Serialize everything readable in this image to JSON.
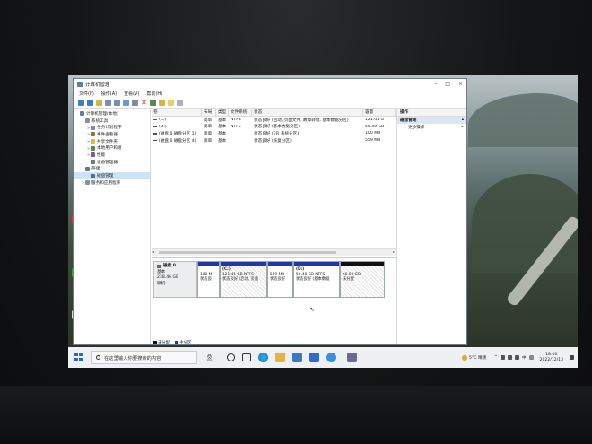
{
  "window": {
    "title": "计算机管理",
    "menu": [
      "文件(F)",
      "操作(A)",
      "查看(V)",
      "帮助(H)"
    ]
  },
  "tree": [
    {
      "label": "计算机管理(本地)",
      "icon": "computer-icon",
      "color": "#5a7ea6",
      "exp": "",
      "indent": 0
    },
    {
      "label": "系统工具",
      "icon": "tools-icon",
      "color": "#8a8f99",
      "exp": "⌄",
      "indent": 1
    },
    {
      "label": "任务计划程序",
      "icon": "clock-icon",
      "color": "#6c8fb8",
      "exp": ">",
      "indent": 2
    },
    {
      "label": "事件查看器",
      "icon": "event-icon",
      "color": "#9b6b3a",
      "exp": ">",
      "indent": 2
    },
    {
      "label": "共享文件夹",
      "icon": "folder-icon",
      "color": "#e2b53c",
      "exp": ">",
      "indent": 2
    },
    {
      "label": "本地用户和组",
      "icon": "users-icon",
      "color": "#5d8a4a",
      "exp": ">",
      "indent": 2
    },
    {
      "label": "性能",
      "icon": "performance-icon",
      "color": "#7a5aa6",
      "exp": ">",
      "indent": 2
    },
    {
      "label": "设备管理器",
      "icon": "device-icon",
      "color": "#6e7680",
      "exp": "",
      "indent": 2
    },
    {
      "label": "存储",
      "icon": "storage-icon",
      "color": "#6e7680",
      "exp": "⌄",
      "indent": 1
    },
    {
      "label": "磁盘管理",
      "icon": "disk-icon",
      "color": "#4f6f99",
      "exp": "",
      "indent": 2,
      "selected": true
    },
    {
      "label": "服务和应用程序",
      "icon": "services-icon",
      "color": "#8a8f99",
      "exp": ">",
      "indent": 1
    }
  ],
  "volume_table": {
    "headers": [
      "卷",
      "布局",
      "类型",
      "文件系统",
      "状态",
      "容量"
    ],
    "rows": [
      [
        "(C:)",
        "简单",
        "基本",
        "NTFS",
        "状态良好 (启动, 页面文件, 故障转储, 基本数据分区)",
        "121.41 G"
      ],
      [
        "(D:)",
        "简单",
        "基本",
        "NTFS",
        "状态良好 (基本数据分区)",
        "56.40 GB"
      ],
      [
        "(磁盘 0 磁盘分区 1)",
        "简单",
        "基本",
        "",
        "状态良好 (EFI 系统分区)",
        "100 MB"
      ],
      [
        "(磁盘 0 磁盘分区 4)",
        "简单",
        "基本",
        "",
        "状态良好 (恢复分区)",
        "559 MB"
      ]
    ]
  },
  "disk": {
    "name": "磁盘 0",
    "type": "基本",
    "size": "238.46 GB",
    "status": "联机",
    "partitions": [
      {
        "name": "",
        "size": "100 M",
        "status": "状态良",
        "kind": "primary",
        "width": 7
      },
      {
        "name": "(C:)",
        "size": "121.41 GB NTFS",
        "status": "状态良好 (启动, 页面",
        "kind": "primary",
        "width": 21
      },
      {
        "name": "",
        "size": "559 MB",
        "status": "状态良好",
        "kind": "primary",
        "width": 11
      },
      {
        "name": "(D:)",
        "size": "56.40 GB NTFS",
        "status": "状态良好 (基本数据",
        "kind": "primary",
        "width": 20
      },
      {
        "name": "",
        "size": "60.00 GB",
        "status": "未分配",
        "kind": "unallocated",
        "width": 20
      }
    ]
  },
  "legend": [
    {
      "label": "未分配",
      "color": "#111111"
    },
    {
      "label": "主分区",
      "color": "#1f3aa8"
    }
  ],
  "actions": {
    "header": "操作",
    "section": "磁盘管理",
    "items": [
      "更多操作"
    ]
  },
  "taskbar": {
    "search_placeholder": "在这里输入你要搜索的内容",
    "weather": "5°C 晴朗",
    "ime": "中",
    "time": "18:00",
    "date": "2022/12/13"
  },
  "colors": {
    "accent": "#1f3aa8",
    "selection": "#cce4f7",
    "taskbar": "#eef0f3"
  }
}
